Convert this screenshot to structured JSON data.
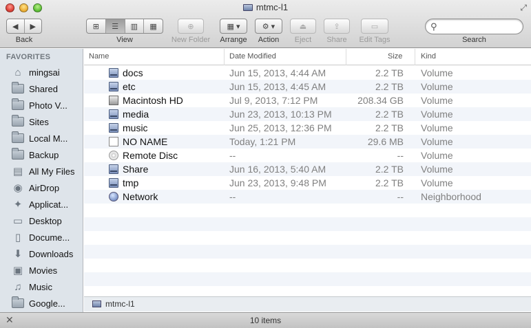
{
  "window": {
    "title": "mtmc-l1"
  },
  "toolbar": {
    "back_label": "Back",
    "view_label": "View",
    "new_folder_label": "New Folder",
    "arrange_label": "Arrange",
    "action_label": "Action",
    "eject_label": "Eject",
    "share_label": "Share",
    "edit_tags_label": "Edit Tags",
    "search_label": "Search",
    "search_value": ""
  },
  "sidebar": {
    "heading": "FAVORITES",
    "items": [
      {
        "label": "mingsai",
        "icon": "home-icon"
      },
      {
        "label": "Shared",
        "icon": "folder-icon"
      },
      {
        "label": "Photo V...",
        "icon": "folder-icon"
      },
      {
        "label": "Sites",
        "icon": "folder-icon"
      },
      {
        "label": "Local M...",
        "icon": "folder-icon"
      },
      {
        "label": "Backup",
        "icon": "folder-icon"
      },
      {
        "label": "All My Files",
        "icon": "all-files-icon"
      },
      {
        "label": "AirDrop",
        "icon": "airdrop-icon"
      },
      {
        "label": "Applicat...",
        "icon": "applications-icon"
      },
      {
        "label": "Desktop",
        "icon": "desktop-icon"
      },
      {
        "label": "Docume...",
        "icon": "documents-icon"
      },
      {
        "label": "Downloads",
        "icon": "downloads-icon"
      },
      {
        "label": "Movies",
        "icon": "movies-icon"
      },
      {
        "label": "Music",
        "icon": "music-icon"
      },
      {
        "label": "Google...",
        "icon": "folder-icon"
      }
    ]
  },
  "list": {
    "columns": {
      "name": "Name",
      "date": "Date Modified",
      "size": "Size",
      "kind": "Kind"
    },
    "rows": [
      {
        "name": "docs",
        "date": "Jun 15, 2013, 4:44 AM",
        "size": "2.2 TB",
        "kind": "Volume",
        "icon": "network-volume-icon"
      },
      {
        "name": "etc",
        "date": "Jun 15, 2013, 4:45 AM",
        "size": "2.2 TB",
        "kind": "Volume",
        "icon": "network-volume-icon"
      },
      {
        "name": "Macintosh HD",
        "date": "Jul 9, 2013, 7:12 PM",
        "size": "208.34 GB",
        "kind": "Volume",
        "icon": "hard-disk-icon"
      },
      {
        "name": "media",
        "date": "Jun 23, 2013, 10:13 PM",
        "size": "2.2 TB",
        "kind": "Volume",
        "icon": "network-volume-icon"
      },
      {
        "name": "music",
        "date": "Jun 25, 2013, 12:36 PM",
        "size": "2.2 TB",
        "kind": "Volume",
        "icon": "network-volume-icon"
      },
      {
        "name": "NO NAME",
        "date": "Today, 1:21 PM",
        "size": "29.6 MB",
        "kind": "Volume",
        "icon": "removable-disk-icon"
      },
      {
        "name": "Remote Disc",
        "date": "--",
        "size": "--",
        "kind": "Volume",
        "icon": "remote-disc-icon"
      },
      {
        "name": "Share",
        "date": "Jun 16, 2013, 5:40 AM",
        "size": "2.2 TB",
        "kind": "Volume",
        "icon": "network-volume-icon"
      },
      {
        "name": "tmp",
        "date": "Jun 23, 2013, 9:48 PM",
        "size": "2.2 TB",
        "kind": "Volume",
        "icon": "network-volume-icon"
      },
      {
        "name": "Network",
        "date": "--",
        "size": "--",
        "kind": "Neighborhood",
        "icon": "network-globe-icon"
      }
    ]
  },
  "pathbar": {
    "label": "mtmc-l1"
  },
  "status": {
    "items_count": "10 items"
  }
}
